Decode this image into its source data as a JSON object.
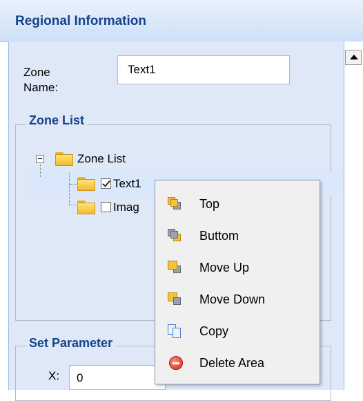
{
  "panel": {
    "title": "Regional Information"
  },
  "zone_name": {
    "label": "Zone Name:",
    "value": "Text1"
  },
  "zone_list": {
    "legend": "Zone List",
    "root_label": "Zone List",
    "items": [
      {
        "label": "Text1",
        "checked": true
      },
      {
        "label": "Imag",
        "checked": false
      }
    ]
  },
  "set_parameter": {
    "legend": "Set Parameter",
    "x_label": "X:",
    "x_value": "0"
  },
  "context_menu": {
    "items": [
      {
        "label": "Top",
        "icon": "bring-to-top-icon"
      },
      {
        "label": "Buttom",
        "icon": "send-to-bottom-icon"
      },
      {
        "label": "Move Up",
        "icon": "move-up-icon"
      },
      {
        "label": "Move Down",
        "icon": "move-down-icon"
      },
      {
        "label": "Copy",
        "icon": "copy-icon"
      },
      {
        "label": "Delete Area",
        "icon": "delete-icon"
      }
    ]
  },
  "colors": {
    "header_text": "#15428b",
    "panel_bg": "#dfe8f6",
    "delete_red": "#d32a1c"
  }
}
